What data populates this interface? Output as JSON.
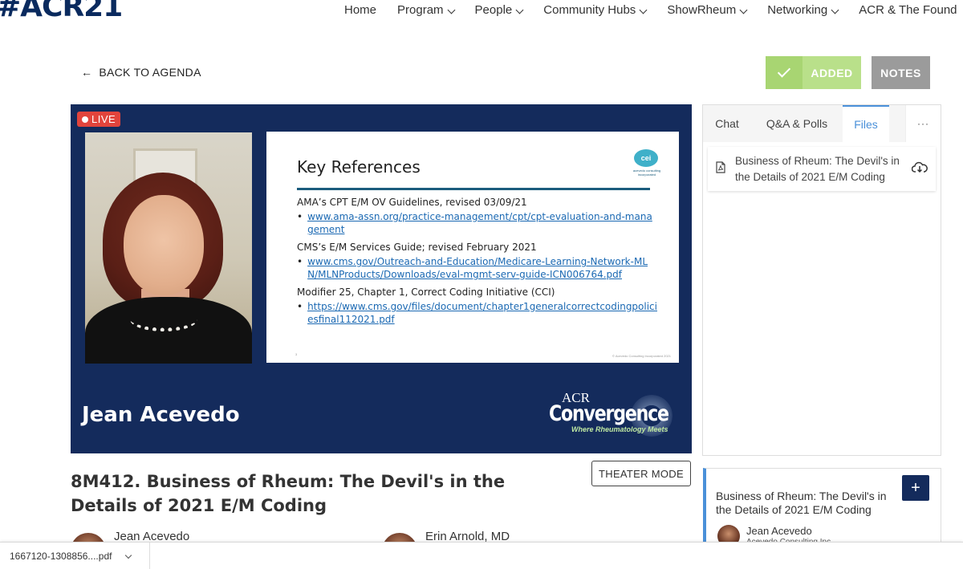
{
  "header": {
    "logo": "#ACR21",
    "nav": [
      {
        "label": "Home",
        "has_menu": false
      },
      {
        "label": "Program",
        "has_menu": true
      },
      {
        "label": "People",
        "has_menu": true
      },
      {
        "label": "Community Hubs",
        "has_menu": true
      },
      {
        "label": "ShowRheum",
        "has_menu": true
      },
      {
        "label": "Networking",
        "has_menu": true
      },
      {
        "label": "ACR & The Found",
        "has_menu": false
      }
    ]
  },
  "actions": {
    "back_label": "BACK TO AGENDA",
    "added_label": "ADDED",
    "notes_label": "NOTES"
  },
  "video": {
    "live_label": "LIVE",
    "speaker_nameplate": "Jean Acevedo",
    "slide": {
      "title": "Key References",
      "logo_text": "cei",
      "logo_sub": "acevedo consulting incorporated",
      "items": [
        {
          "heading": "AMA’s CPT E/M OV Guidelines, revised 03/09/21",
          "link": "www.ama-assn.org/practice-management/cpt/cpt-evaluation-and-management"
        },
        {
          "heading": "CMS’s E/M Services Guide; revised February 2021",
          "link": "www.cms.gov/Outreach-and-Education/Medicare-Learning-Network-MLN/MLNProducts/Downloads/eval-mgmt-serv-guide-ICN006764.pdf"
        },
        {
          "heading": "Modifier 25, Chapter 1, Correct Coding Initiative (CCI)",
          "link": "https://www.cms.gov/files/document/chapter1generalcorrectcodingpoliciesfinal112021.pdf"
        }
      ],
      "footer": "© Acevedo Consulting Incorporated 2021",
      "page_number": "3"
    },
    "brand": {
      "line1": "ACR",
      "line2": "Convergence",
      "tagline": "Where Rheumatology Meets"
    }
  },
  "session": {
    "title": "8M412. Business of Rheum: The Devil's in the Details of 2021 E/M Coding",
    "theater_label": "THEATER MODE",
    "speakers": [
      {
        "name": "Jean Acevedo"
      },
      {
        "name": "Erin Arnold, MD"
      }
    ]
  },
  "panel": {
    "tabs": [
      {
        "label": "Chat",
        "active": false
      },
      {
        "label": "Q&A & Polls",
        "active": false
      },
      {
        "label": "Files",
        "active": true
      }
    ],
    "more_label": "···",
    "files": [
      {
        "name": "Business of Rheum: The Devil's in the Details of 2021 E/M Coding",
        "type_icon": "pdf-file-icon",
        "action_icon": "cloud-download-icon"
      }
    ]
  },
  "agenda_card": {
    "title": "Business of Rheum: The Devil's in the Details of 2021 E/M Coding",
    "speaker_name": "Jean Acevedo",
    "speaker_company": "Acevedo Consulting Inc",
    "add_label": "+"
  },
  "download_bar": {
    "filename": "1667120-1308856....pdf"
  },
  "colors": {
    "navy": "#142b5c",
    "added_green": "#b9e08a",
    "notes_gray": "#9b9b9b",
    "live_red": "#e2443c",
    "accent_blue": "#4a90d9"
  }
}
